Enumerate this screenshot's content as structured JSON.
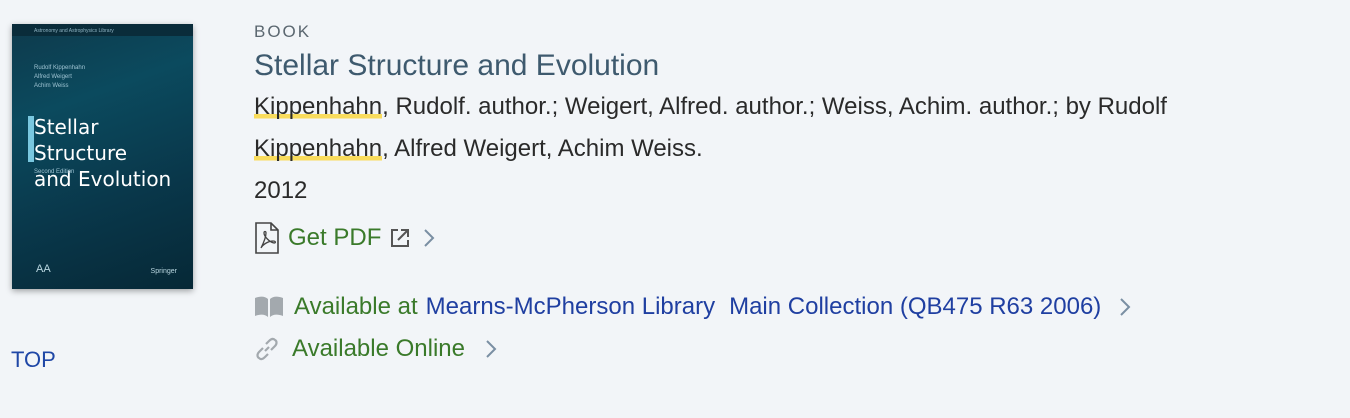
{
  "record": {
    "type": "BOOK",
    "title": "Stellar Structure and Evolution",
    "authors_line1_parts": [
      "Kippenhahn",
      ", Rudolf. author.; Weigert, Alfred. author.; Weiss, Achim. author.; by Rudolf"
    ],
    "authors_line2_parts": [
      "Kippenhahn",
      ", Alfred Weigert, Achim Weiss."
    ],
    "year": "2012"
  },
  "cover": {
    "series": "Astronomy and Astrophysics Library",
    "authors": [
      "Rudolf Kippenhahn",
      "Alfred Weigert",
      "Achim Weiss"
    ],
    "title_line1": "Stellar Structure",
    "title_line2": "and Evolution",
    "edition": "Second Edition",
    "logo_text": "AA",
    "publisher": "Springer"
  },
  "links": {
    "get_pdf": "Get PDF",
    "available_at_prefix": "Available at",
    "library": "Mearns-McPherson Library",
    "location": "Main Collection (QB475 R63 2006)",
    "available_online": "Available Online",
    "top": "TOP"
  },
  "icons": {
    "pdf": "pdf-file-icon",
    "external": "external-link-icon",
    "book": "open-book-icon",
    "link": "chain-link-icon",
    "chevron": "chevron-right-icon"
  },
  "colors": {
    "background": "#f2f5f8",
    "title": "#3e5a6e",
    "green_link": "#3a7a2a",
    "blue_link": "#1f3fa1",
    "highlight": "#f9dc5c"
  }
}
